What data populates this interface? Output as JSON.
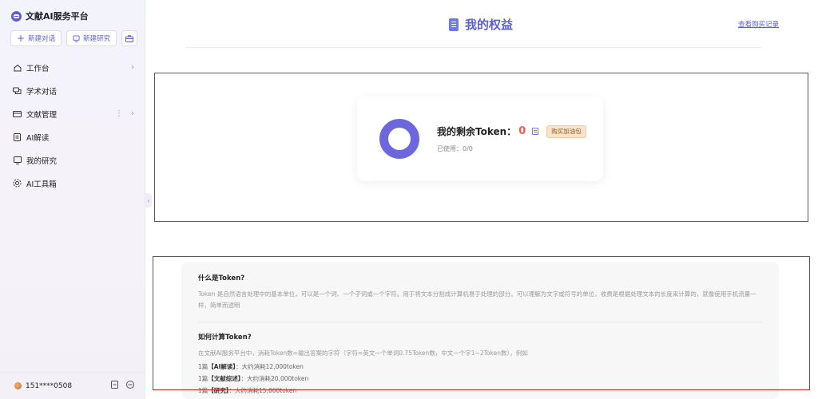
{
  "sidebar": {
    "brand": "文献AI服务平台",
    "new_chat": "新建对话",
    "new_research": "新建研究",
    "nav": [
      {
        "label": "工作台"
      },
      {
        "label": "学术对话"
      },
      {
        "label": "文献管理"
      },
      {
        "label": "AI解读"
      },
      {
        "label": "我的研究"
      },
      {
        "label": "AI工具箱"
      }
    ],
    "user": "151****0508"
  },
  "header": {
    "title": "我的权益",
    "purchase_records": "查看购买记录"
  },
  "token": {
    "title": "我的剩余Token：",
    "remaining": "0",
    "buy_label": "购买加油包",
    "used": "已使用：0/0"
  },
  "info": {
    "what_title": "什么是Token?",
    "what_text": "Token 是自然语言处理中的基本单位，可以是一个词、一个子词或一个字符。用于将文本分割成计算机易于处理的部分。可以理解为文字或符号的单位，收费是根据处理文本的长度来计算的，就像使用手机流量一样，简单而透明",
    "how_title": "如何计算Token?",
    "how_text": "在文献AI服务平台中，消耗Token数=输出答案的字符（字符=英文一个单词0.75Token数，中文一个字1~2Token数），例如",
    "examples": [
      {
        "prefix": "1篇",
        "name": "【AI解读】",
        "value": "：大约消耗12,000token"
      },
      {
        "prefix": "1篇",
        "name": "【文献综述】",
        "value": "：大约消耗20,000token"
      },
      {
        "prefix": "1篇",
        "name": "【研究】",
        "value": "：大约消耗15,000token"
      }
    ]
  },
  "colors": {
    "accent": "#5b5fd6",
    "token_zero": "#f45c4d",
    "donut": "#6c67dc",
    "highlight_box": "#e02020"
  }
}
